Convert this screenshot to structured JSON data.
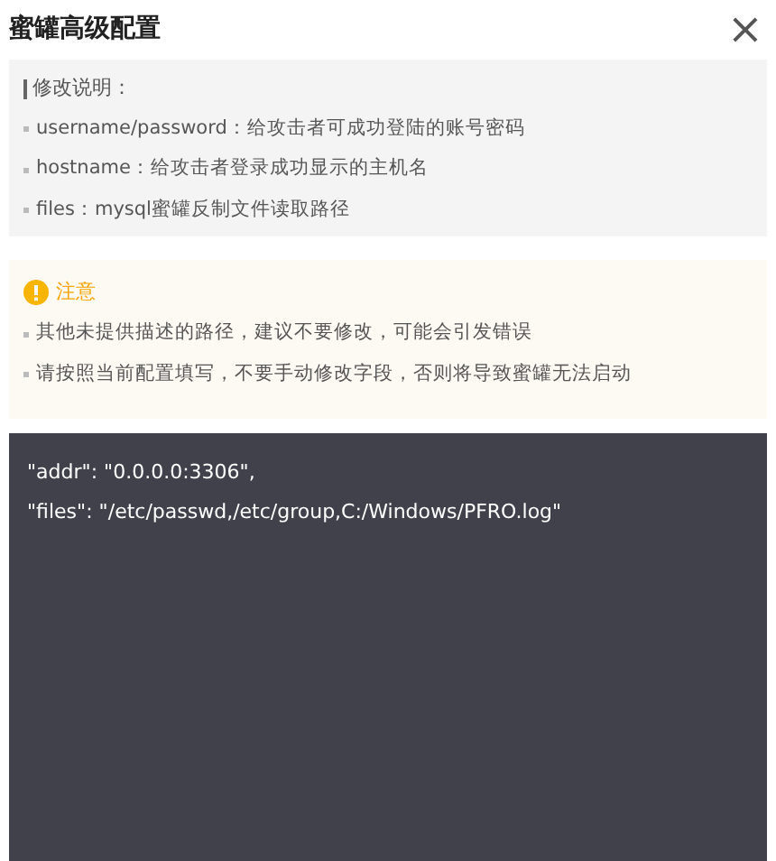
{
  "dialog": {
    "title": "蜜罐高级配置",
    "close": "×"
  },
  "info": {
    "heading": "修改说明：",
    "items": [
      "username/password：给攻击者可成功登陆的账号密码",
      "hostname：给攻击者登录成功显示的主机名",
      "files：mysql蜜罐反制文件读取路径"
    ]
  },
  "notice": {
    "title": "注意",
    "items": [
      "其他未提供描述的路径，建议不要修改，可能会引发错误",
      "请按照当前配置填写，不要手动修改字段，否则将导致蜜罐无法启动"
    ]
  },
  "editor": {
    "lines": [
      "\"addr\": \"0.0.0.0:3306\",",
      "\"files\": \"/etc/passwd,/etc/group,C:/Windows/PFRO.log\""
    ]
  }
}
